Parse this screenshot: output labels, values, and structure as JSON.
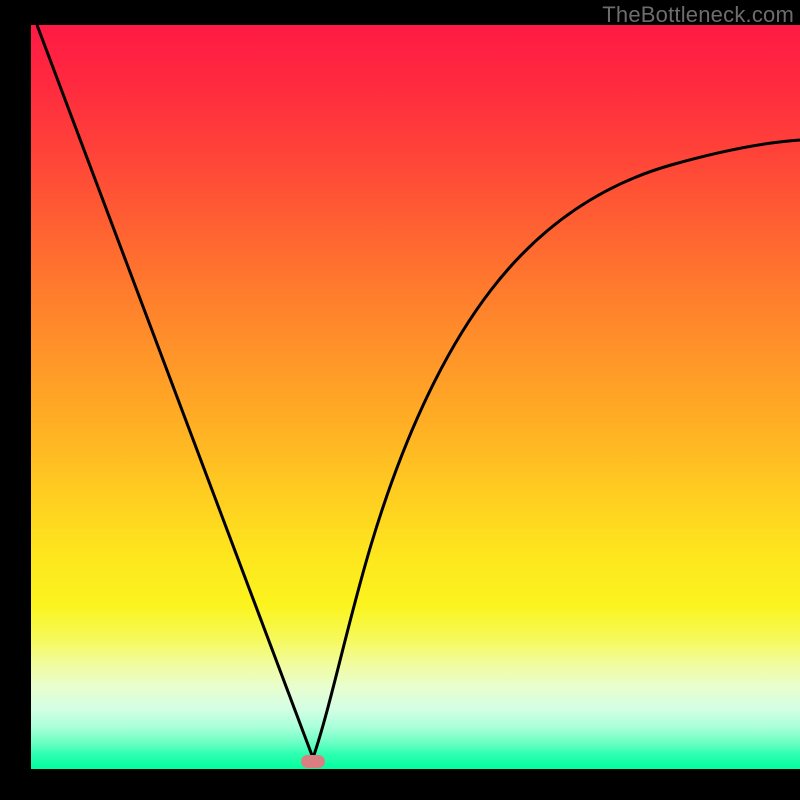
{
  "watermark": "TheBottleneck.com",
  "chart_data": {
    "type": "line",
    "title": "",
    "xlabel": "",
    "ylabel": "",
    "xlim": [
      0,
      100
    ],
    "ylim": [
      0,
      100
    ],
    "grid": false,
    "series": [
      {
        "name": "bottleneck-curve",
        "x": [
          0,
          5,
          10,
          15,
          20,
          25,
          30,
          32,
          34,
          36,
          37,
          38,
          40,
          42,
          45,
          50,
          55,
          60,
          65,
          70,
          75,
          80,
          85,
          90,
          95,
          100
        ],
        "y": [
          100,
          86,
          72,
          58,
          44,
          30,
          16,
          10,
          4,
          1,
          0,
          1,
          5,
          12,
          23,
          38,
          49,
          58,
          64,
          69,
          72.5,
          75,
          77,
          78.5,
          79.5,
          80
        ]
      }
    ],
    "marker": {
      "x": 37,
      "y": 0
    },
    "background_gradient": {
      "top": "#ff1a44",
      "mid": "#ffd020",
      "bottom": "#00ff9e"
    }
  }
}
